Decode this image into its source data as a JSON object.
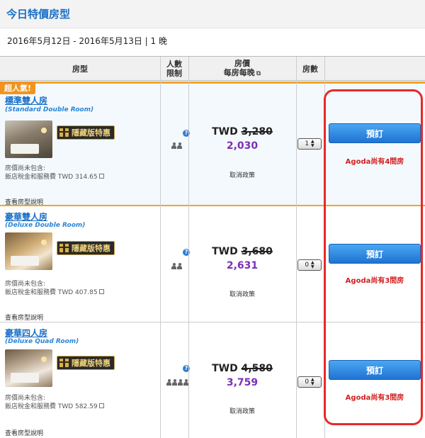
{
  "header": {
    "title": "今日特價房型"
  },
  "date_range": "2016年5月12日 - 2016年5月13日 | 1 晚",
  "columns": {
    "room_type": "房型",
    "occupancy_line1": "人數",
    "occupancy_line2": "限制",
    "price_line1": "房價",
    "price_line2": "每房每晚",
    "rooms": "房數"
  },
  "rooms": [
    {
      "badge": "超人氣!",
      "name": "標準雙人房",
      "name_en": "(Standard Double Room)",
      "promo": "隱藏版特惠",
      "tax_label": "房價尚未包含:",
      "tax_value": "飯店稅金和服務費 TWD 314.65",
      "view_link": "查看房型說明",
      "help": "?",
      "occupancy": 2,
      "currency": "TWD",
      "original_price": "3,280",
      "price": "2,030",
      "cancel": "取消政策",
      "qty": "1",
      "book": "預訂",
      "availability": "Agoda尚有4間房"
    },
    {
      "name": "豪華雙人房",
      "name_en": "(Deluxe Double Room)",
      "promo": "隱藏版特惠",
      "tax_label": "房價尚未包含:",
      "tax_value": "飯店稅金和服務費 TWD 407.85",
      "view_link": "查看房型說明",
      "help": "?",
      "occupancy": 2,
      "currency": "TWD",
      "original_price": "3,680",
      "price": "2,631",
      "cancel": "取消政策",
      "qty": "0",
      "book": "預訂",
      "availability": "Agoda尚有3間房"
    },
    {
      "name": "豪華四人房",
      "name_en": "(Deluxe Quad Room)",
      "promo": "隱藏版特惠",
      "tax_label": "房價尚未包含:",
      "tax_value": "飯店稅金和服務費 TWD 582.59",
      "view_link": "查看房型說明",
      "help": "?",
      "occupancy": 4,
      "currency": "TWD",
      "original_price": "4,580",
      "price": "3,759",
      "cancel": "取消政策",
      "qty": "0",
      "book": "預訂",
      "availability": "Agoda尚有3間房"
    }
  ],
  "colors": {
    "accent_blue": "#1a6fc6",
    "discount_purple": "#7b2fb5",
    "highlight_red": "#e52a2a",
    "popular_orange": "#f0941e"
  }
}
